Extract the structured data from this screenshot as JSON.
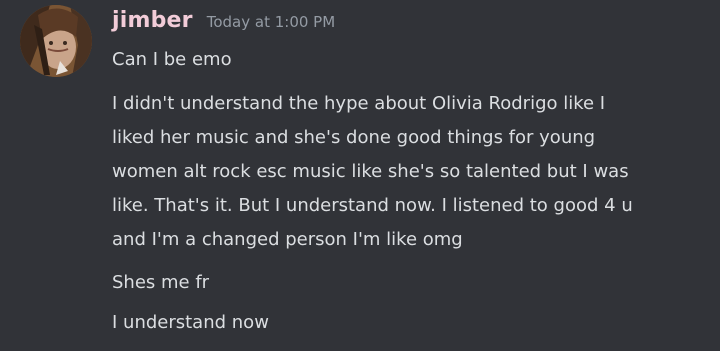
{
  "message": {
    "username": "jimber",
    "timestamp": "Today at 1:00 PM",
    "avatar": "avatar-image",
    "lines": [
      "Can I be emo"
    ],
    "paragraph": [
      "I didn't understand the hype about Olivia Rodrigo like I",
      "liked her music and she's done good things for young",
      "women alt rock esc music like she's so talented but I was",
      "like. That's it. But I understand now. I listened to good 4 u",
      "and I'm a changed person I'm like omg"
    ],
    "followups": [
      "Shes me fr",
      "I understand now"
    ]
  },
  "colors": {
    "background": "#313338",
    "username": "#f2ccd8",
    "timestamp": "#949ba4",
    "text": "#dbdee1"
  }
}
